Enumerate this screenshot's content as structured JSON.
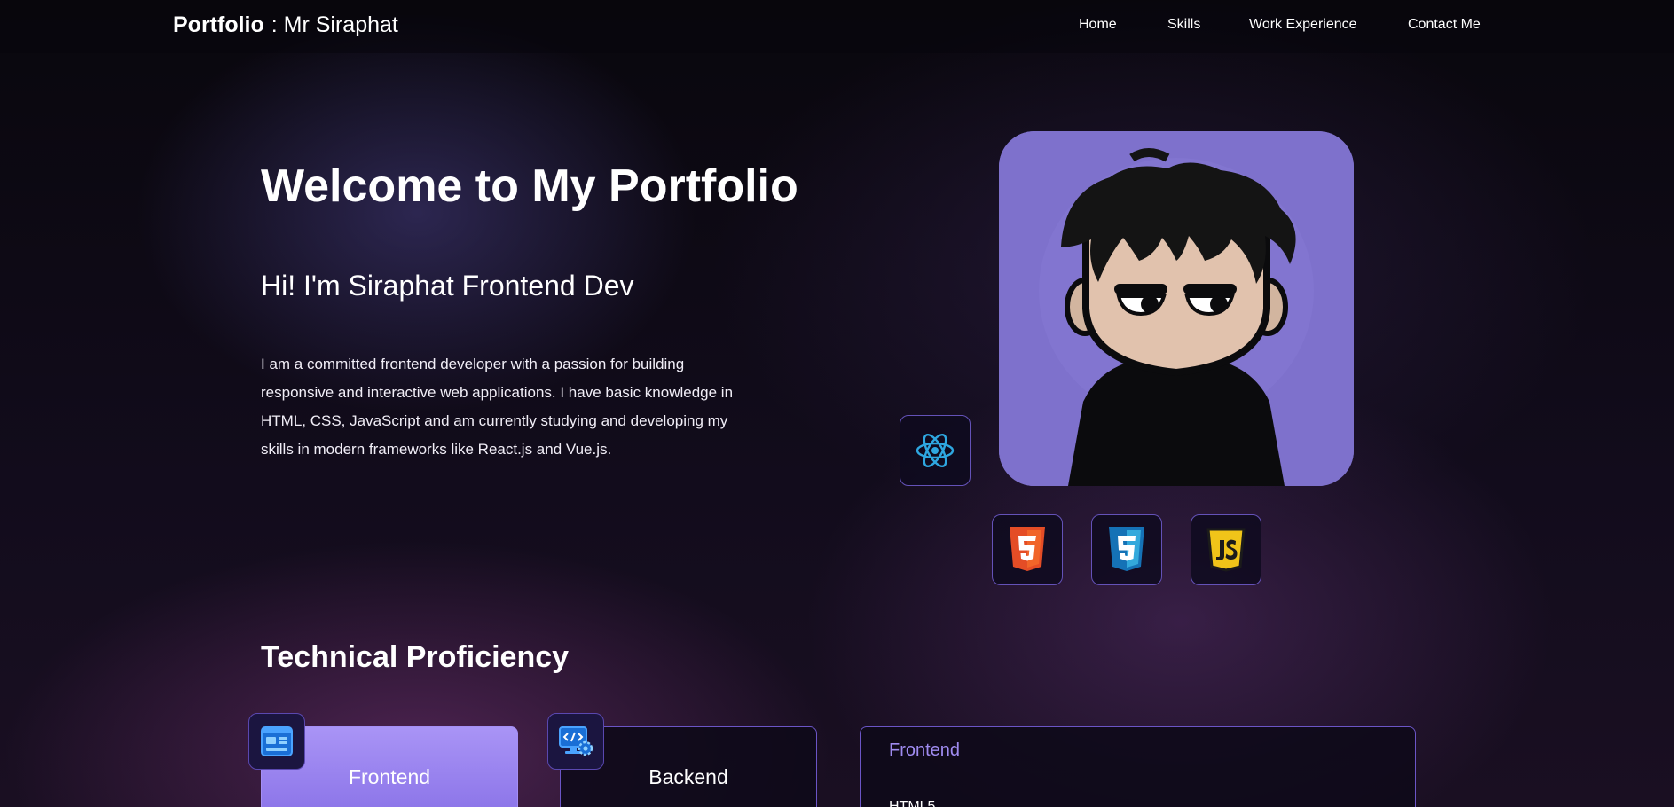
{
  "nav": {
    "brand_bold": "Portfolio",
    "brand_rest": ": Mr Siraphat",
    "items": [
      "Home",
      "Skills",
      "Work Experience",
      "Contact Me"
    ]
  },
  "hero": {
    "title": "Welcome to My Portfolio",
    "subtitle": "Hi! I'm Siraphat Frontend Dev",
    "description": "I am a committed frontend developer with a passion for building responsive and interactive web applications. I have basic knowledge in HTML, CSS, JavaScript and am currently studying and developing my skills in modern frameworks like React.js and Vue.js."
  },
  "tech_icons": [
    "react-icon",
    "html5-icon",
    "css3-icon",
    "javascript-icon"
  ],
  "skills": {
    "title": "Technical Proficiency",
    "cards": [
      {
        "label": "Frontend",
        "icon": "frontend-layout-icon",
        "active": true
      },
      {
        "label": "Backend",
        "icon": "backend-code-gear-icon",
        "active": false
      }
    ],
    "panel": {
      "heading": "Frontend",
      "items": [
        "HTML5"
      ]
    }
  },
  "colors": {
    "accent": "#7e71cc",
    "active_card": "#9d88f2",
    "border": "#6b55c6",
    "panel_heading": "#9f8bf0",
    "html5": "#e44d26",
    "css3": "#2965f1",
    "javascript": "#f7df1e",
    "react": "#2ea7e0"
  }
}
